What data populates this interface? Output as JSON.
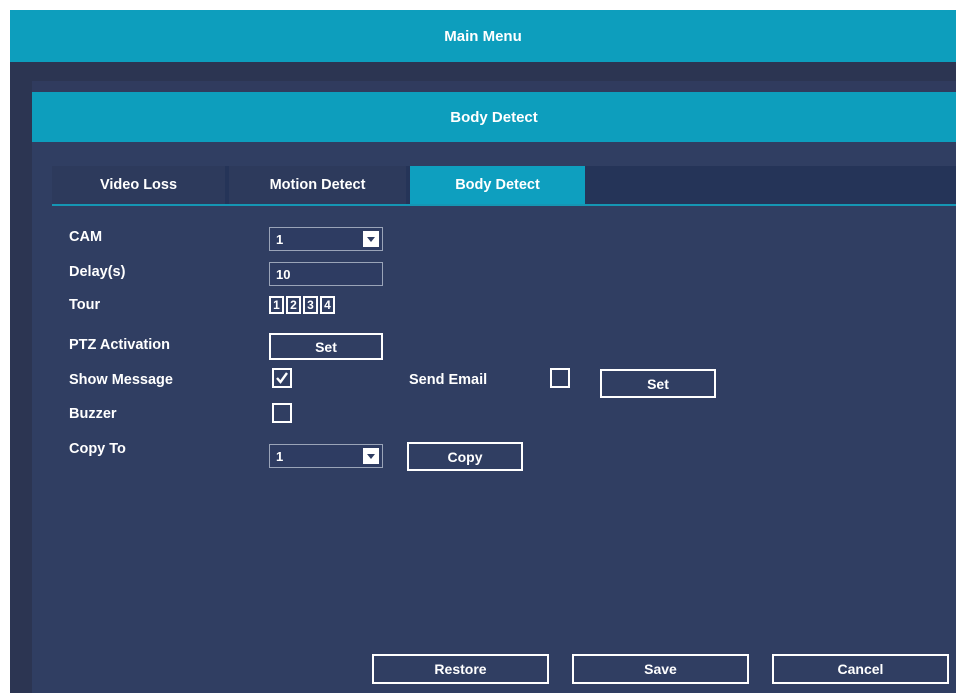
{
  "header": {
    "title": "Main Menu"
  },
  "dialog": {
    "title": "Body Detect"
  },
  "tabs": [
    {
      "label": "Video Loss",
      "active": false
    },
    {
      "label": "Motion Detect",
      "active": false
    },
    {
      "label": "Body Detect",
      "active": true
    }
  ],
  "form": {
    "cam": {
      "label": "CAM",
      "value": "1"
    },
    "delay": {
      "label": "Delay(s)",
      "value": "10"
    },
    "tour": {
      "label": "Tour",
      "channels": [
        "1",
        "2",
        "3",
        "4"
      ]
    },
    "ptz": {
      "label": "PTZ Activation",
      "button": "Set"
    },
    "show_message": {
      "label": "Show Message",
      "checked": true
    },
    "send_email": {
      "label": "Send Email",
      "checked": false,
      "button": "Set"
    },
    "buzzer": {
      "label": "Buzzer",
      "checked": false
    },
    "copy_to": {
      "label": "Copy To",
      "value": "1",
      "button": "Copy"
    }
  },
  "footer": {
    "restore": "Restore",
    "save": "Save",
    "cancel": "Cancel"
  },
  "colors": {
    "accent": "#0d9ebd",
    "panel": "#303e62",
    "tabbar": "#253458"
  }
}
